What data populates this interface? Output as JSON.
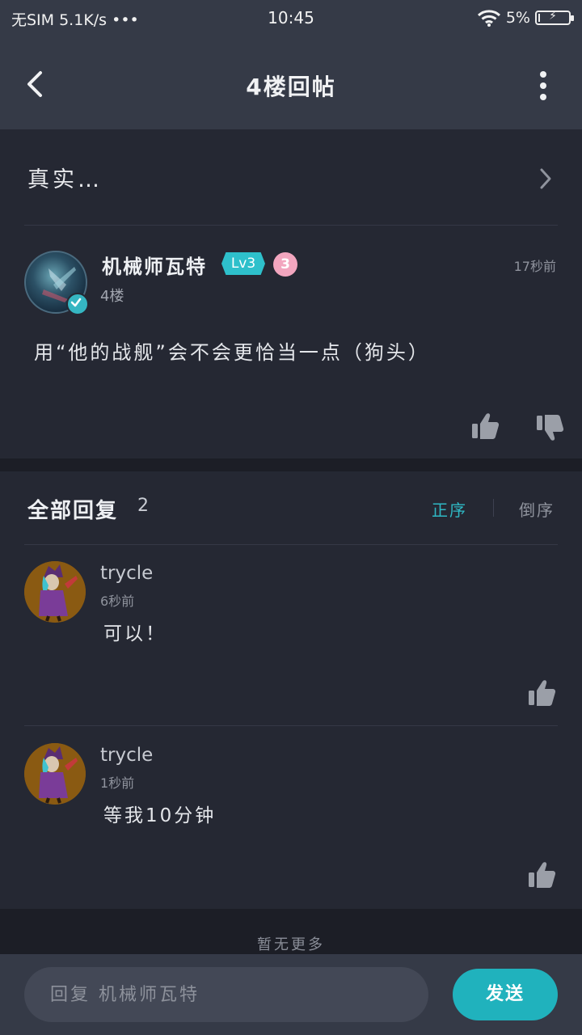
{
  "status_bar": {
    "carrier": "无SIM 5.1K/s •••",
    "time": "10:45",
    "battery": "5%",
    "battery_level": 0.05
  },
  "header": {
    "title": "4楼回帖",
    "back_icon": "chevron-left-icon",
    "more_icon": "more-vertical-icon"
  },
  "topic": {
    "title": "真实…",
    "author": {
      "name": "机械师瓦特",
      "level": "Lv3",
      "badge": "3",
      "floor": "4楼",
      "time": "17秒前"
    },
    "content": "用“他的战舰”会不会更恰当一点（狗头）"
  },
  "replies": {
    "title": "全部回复",
    "count": "2",
    "sort_asc": "正序",
    "sort_desc": "倒序",
    "items": [
      {
        "user": "trycle",
        "time": "6秒前",
        "text": "可以！"
      },
      {
        "user": "trycle",
        "time": "1秒前",
        "text": "等我10分钟"
      }
    ]
  },
  "footer": {
    "no_more": "暂无更多",
    "input_placeholder": "回复 机械师瓦特",
    "send_label": "发送"
  },
  "colors": {
    "accent": "#20b2bd",
    "background": "#1c1e26",
    "card": "#252833",
    "bar": "#353a47"
  }
}
